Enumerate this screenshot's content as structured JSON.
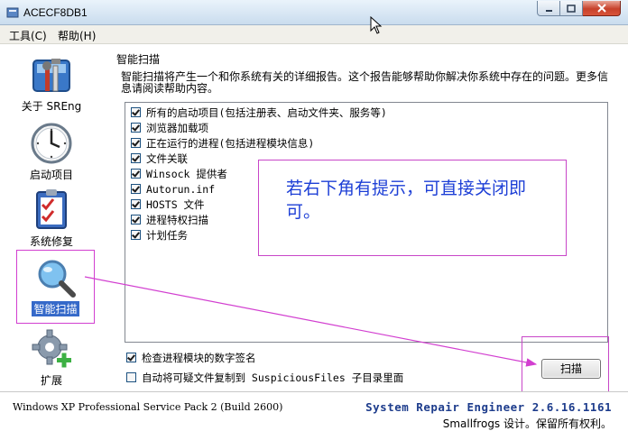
{
  "window": {
    "title": "ACECF8DB1"
  },
  "menu": {
    "tools": "工具(C)",
    "help": "帮助(H)"
  },
  "sidebar": {
    "items": [
      {
        "label": "关于 SREng",
        "icon": "toolbox-icon"
      },
      {
        "label": "启动项目",
        "icon": "clock-icon"
      },
      {
        "label": "系统修复",
        "icon": "checklist-icon"
      },
      {
        "label": "智能扫描",
        "icon": "magnifier-icon",
        "selected": true
      },
      {
        "label": "扩展",
        "icon": "gear-plus-icon"
      }
    ]
  },
  "main": {
    "section_title": "智能扫描",
    "description": "智能扫描将产生一个和你系统有关的详细报告。这个报告能够帮助你解决你系统中存在的问题。更多信息请阅读帮助内容。",
    "items": [
      {
        "label": "所有的启动项目(包括注册表、启动文件夹、服务等)",
        "checked": true
      },
      {
        "label": "浏览器加载项",
        "checked": true
      },
      {
        "label": "正在运行的进程(包括进程模块信息)",
        "checked": true
      },
      {
        "label": "文件关联",
        "checked": true
      },
      {
        "label": "Winsock 提供者",
        "checked": true
      },
      {
        "label": "Autorun.inf",
        "checked": true
      },
      {
        "label": "HOSTS 文件",
        "checked": true
      },
      {
        "label": "进程特权扫描",
        "checked": true
      },
      {
        "label": "计划任务",
        "checked": true
      }
    ],
    "options": [
      {
        "label": "检查进程模块的数字签名",
        "checked": true
      },
      {
        "label": "自动将可疑文件复制到 SuspiciousFiles 子目录里面",
        "checked": false
      }
    ],
    "scan_button": "扫描"
  },
  "annotation": {
    "text": "若右下角有提示，可直接关闭即可。"
  },
  "status": {
    "os": "Windows XP Professional Service Pack 2 (Build 2600)",
    "product": "System Repair Engineer 2.6.16.1161",
    "copyright": "Smallfrogs 设计。保留所有权利。"
  },
  "colors": {
    "annotation_border": "#c846c8",
    "annotation_text": "#1d3fd6",
    "product_text": "#1d3c8c"
  }
}
